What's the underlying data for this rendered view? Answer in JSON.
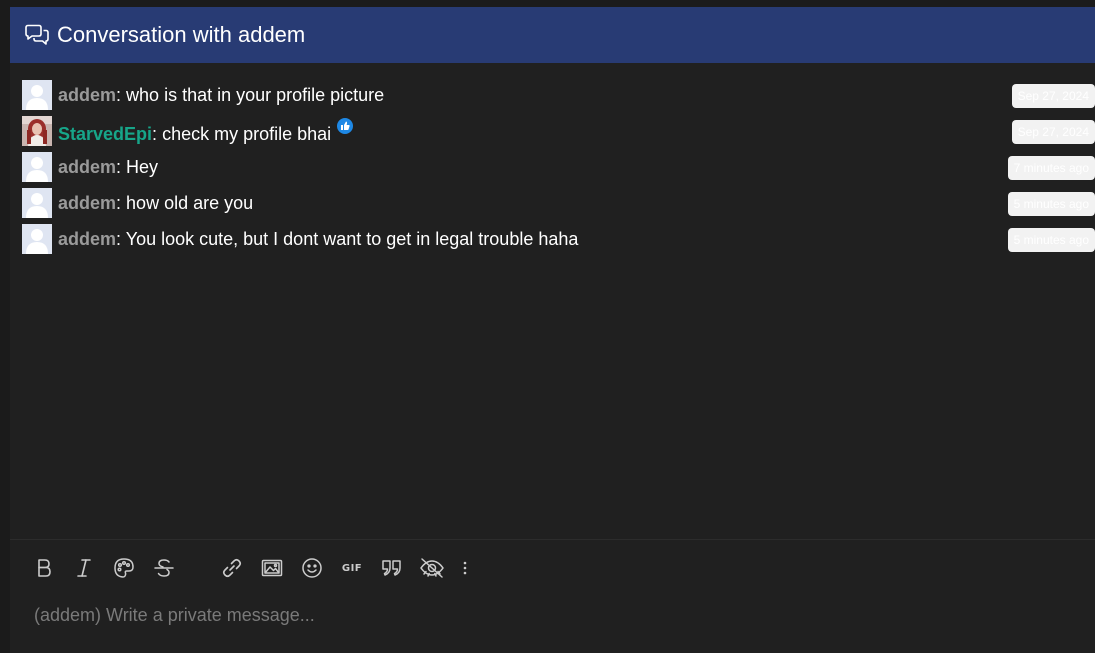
{
  "header": {
    "title": "Conversation with addem",
    "icon": "chat-bubbles-icon",
    "background": "#283b74"
  },
  "colors": {
    "addem_name": "#9a9a9a",
    "starved_name": "#17a589",
    "accent_like": "#1e88e5"
  },
  "messages": [
    {
      "user": "addem",
      "text": "who is that in your profile picture",
      "time": "Sep 27, 2024",
      "avatar": "default-avatar"
    },
    {
      "user": "StarvedEpi",
      "text": "check my profile bhai",
      "time": "Sep 27, 2024",
      "avatar": "user-photo-avatar",
      "badge": "thumbs-up-icon"
    },
    {
      "user": "addem",
      "text": "Hey",
      "time": "7 minutes ago",
      "avatar": "default-avatar"
    },
    {
      "user": "addem",
      "text": "how old are you",
      "time": "5 minutes ago",
      "avatar": "default-avatar"
    },
    {
      "user": "addem",
      "text": "You look cute, but I dont want to get in legal trouble haha",
      "time": "5 minutes ago",
      "avatar": "default-avatar"
    }
  ],
  "toolbar": {
    "buttons": [
      "bold-icon",
      "italic-icon",
      "palette-icon",
      "strikethrough-icon",
      "link-icon",
      "image-icon",
      "emoji-icon",
      "gif-icon",
      "quote-icon",
      "spoiler-icon",
      "more-icon"
    ],
    "gif_label": "GIF"
  },
  "composer": {
    "placeholder": "(addem) Write a private message..."
  }
}
